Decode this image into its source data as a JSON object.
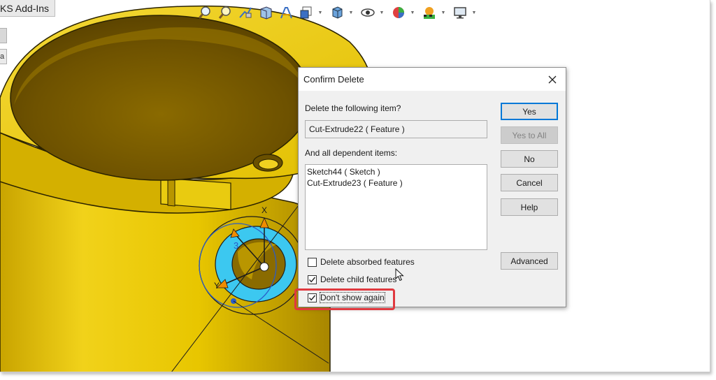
{
  "app": {
    "tab_label": "KS Add-Ins",
    "side_tab_text": "a"
  },
  "toolbar": {
    "icons": [
      "zoom-to-fit-icon",
      "zoom-to-area-icon",
      "previous-view-icon",
      "section-view-icon",
      "dynamic-annotation-icon",
      "view-orientation-icon",
      "display-style-icon",
      "hide-show-icon",
      "edit-appearance-icon",
      "apply-scene-icon",
      "view-settings-icon"
    ]
  },
  "triad": {
    "x_label": "X",
    "y_label": "Y"
  },
  "dialog": {
    "title": "Confirm Delete",
    "prompt": "Delete the following item?",
    "item": "Cut-Extrude22 ( Feature )",
    "dependents_label": "And all dependent items:",
    "dependents": [
      "Sketch44 ( Sketch )",
      "Cut-Extrude23 ( Feature )"
    ],
    "buttons": {
      "yes": "Yes",
      "yes_to_all": "Yes to All",
      "no": "No",
      "cancel": "Cancel",
      "help": "Help",
      "advanced": "Advanced"
    },
    "checkboxes": {
      "absorbed": {
        "label": "Delete absorbed features",
        "checked": false
      },
      "child": {
        "label": "Delete child features",
        "checked": true
      },
      "dont_show": {
        "label": "Don't show again",
        "checked": true
      }
    },
    "highlight_color": "#e0393f",
    "accent_color": "#0078d7"
  },
  "colors": {
    "part_yellow": "#e8c600",
    "selection_cyan": "#3cc8f0"
  }
}
